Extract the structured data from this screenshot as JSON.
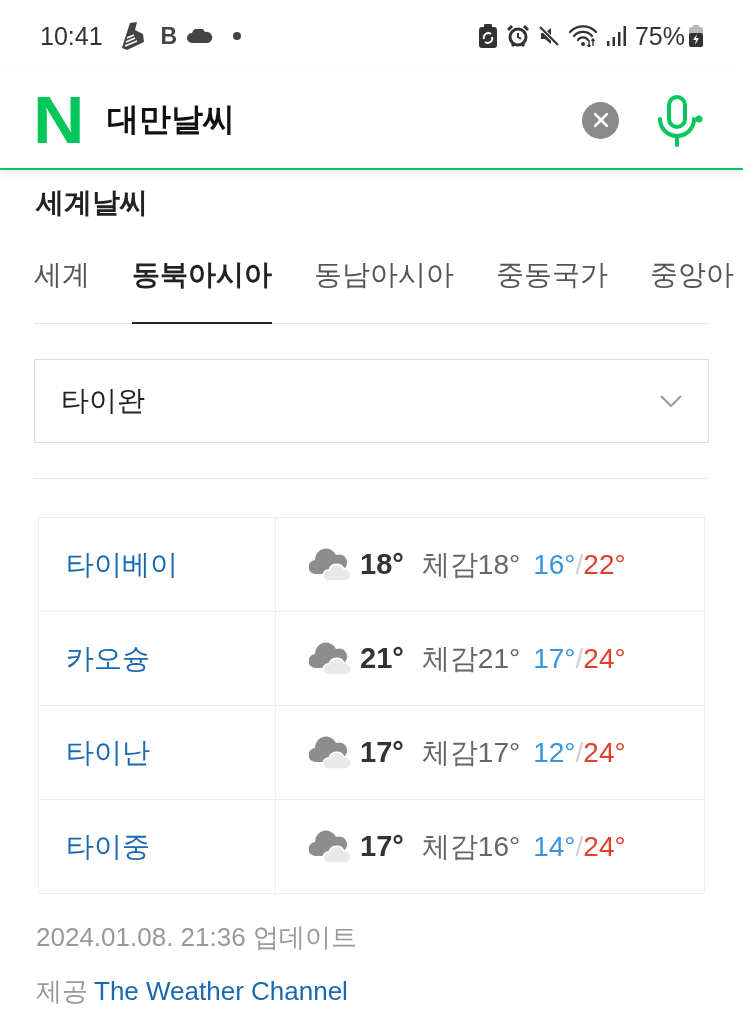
{
  "status_bar": {
    "time": "10:41",
    "notification_letter": "B",
    "battery": "75%"
  },
  "search_bar": {
    "logo": "N",
    "query": "대만날씨"
  },
  "section": {
    "title": "세계날씨"
  },
  "tabs": [
    {
      "label": "세계",
      "selected": false
    },
    {
      "label": "동북아시아",
      "selected": true
    },
    {
      "label": "동남아시아",
      "selected": false
    },
    {
      "label": "중동국가",
      "selected": false
    },
    {
      "label": "중앙아",
      "selected": false
    }
  ],
  "dropdown": {
    "value": "타이완"
  },
  "weather_table": {
    "rows": [
      {
        "city": "타이베이",
        "temperature": "18°",
        "feels_like": "체감18°",
        "low": "16°",
        "separator": "/",
        "high": "22°"
      },
      {
        "city": "카오슝",
        "temperature": "21°",
        "feels_like": "체감21°",
        "low": "17°",
        "separator": "/",
        "high": "24°"
      },
      {
        "city": "타이난",
        "temperature": "17°",
        "feels_like": "체감17°",
        "low": "12°",
        "separator": "/",
        "high": "24°"
      },
      {
        "city": "타이중",
        "temperature": "17°",
        "feels_like": "체감16°",
        "low": "14°",
        "separator": "/",
        "high": "24°"
      }
    ]
  },
  "footer": {
    "updated": "2024.01.08. 21:36 업데이트",
    "provider_label": "제공",
    "provider": "The Weather Channel"
  }
}
